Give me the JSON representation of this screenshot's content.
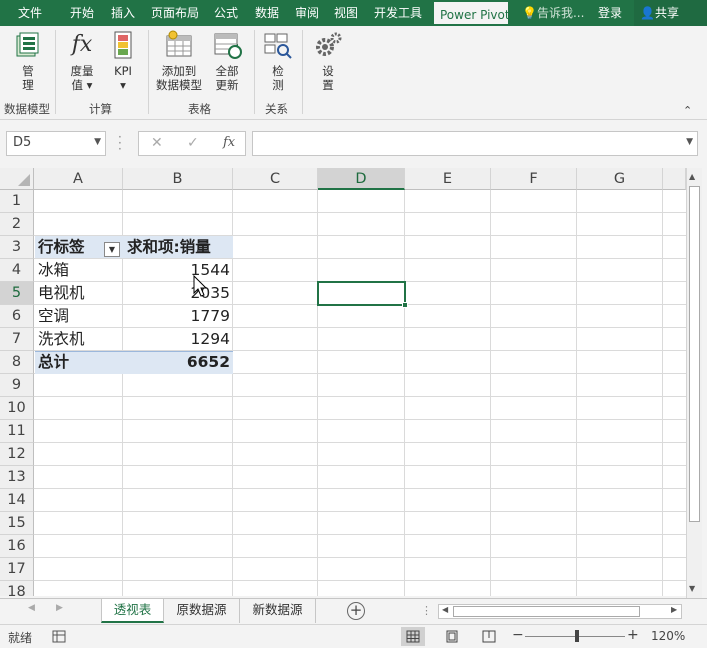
{
  "menu": {
    "file": "文件",
    "tabs": [
      "开始",
      "插入",
      "页面布局",
      "公式",
      "数据",
      "审阅",
      "视图",
      "开发工具"
    ],
    "active_tab": "Power Pivot",
    "tell_me": "告诉我...",
    "login": "登录",
    "share": "共享"
  },
  "ribbon": {
    "manage": "管\n理",
    "measure": "度量\n值 ▾",
    "kpi": "KPI\n▾",
    "add_to_model": "添加到\n数据模型",
    "refresh_all": "全部\n更新",
    "detect": "检\n测",
    "settings": "设\n置",
    "groups": {
      "data_model": "数据模型",
      "calc": "计算",
      "tables": "表格",
      "relations": "关系"
    }
  },
  "formula_bar": {
    "name_box": "D5",
    "cancel": "✕",
    "enter": "✓",
    "fx": "fx",
    "value": ""
  },
  "grid": {
    "columns": [
      "A",
      "B",
      "C",
      "D",
      "E",
      "F",
      "G"
    ],
    "rows": [
      "1",
      "2",
      "3",
      "4",
      "5",
      "6",
      "7",
      "8",
      "9",
      "10",
      "11",
      "12",
      "13",
      "14",
      "15",
      "16",
      "17",
      "18"
    ],
    "pivot": {
      "row_label_header": "行标签",
      "value_header": "求和项:销量",
      "items": [
        {
          "label": "冰箱",
          "value": "1544"
        },
        {
          "label": "电视机",
          "value": "2035"
        },
        {
          "label": "空调",
          "value": "1779"
        },
        {
          "label": "洗衣机",
          "value": "1294"
        }
      ],
      "total_label": "总计",
      "total_value": "6652"
    }
  },
  "sheets": [
    "透视表",
    "原数据源",
    "新数据源"
  ],
  "status": {
    "ready": "就绪",
    "zoom": "120%"
  }
}
